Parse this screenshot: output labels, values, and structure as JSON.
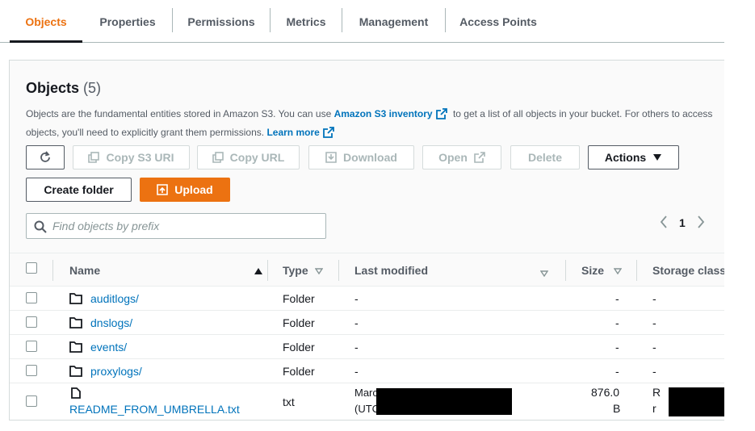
{
  "tabs": [
    "Objects",
    "Properties",
    "Permissions",
    "Metrics",
    "Management",
    "Access Points"
  ],
  "panel": {
    "title": "Objects",
    "count": "(5)",
    "desc_part1": "Objects are the fundamental entities stored in Amazon S3. You can use ",
    "desc_link1": "Amazon S3 inventory",
    "desc_part2": " to get a list of all objects in your bucket. For others to access objects, you'll need to explicitly grant them permissions. ",
    "desc_link2": "Learn more"
  },
  "toolbar": {
    "copy_s3_uri": "Copy S3 URI",
    "copy_url": "Copy URL",
    "download": "Download",
    "open": "Open",
    "delete": "Delete",
    "actions": "Actions",
    "create_folder": "Create folder",
    "upload": "Upload"
  },
  "search": {
    "placeholder": "Find objects by prefix"
  },
  "pager": {
    "page": "1"
  },
  "table": {
    "headers": {
      "name": "Name",
      "type": "Type",
      "last_modified": "Last modified",
      "size": "Size",
      "storage_class": "Storage class"
    },
    "rows": [
      {
        "name": "auditlogs/",
        "type": "Folder",
        "last_modified": "-",
        "size": "-",
        "storage_class": "-"
      },
      {
        "name": "dnslogs/",
        "type": "Folder",
        "last_modified": "-",
        "size": "-",
        "storage_class": "-"
      },
      {
        "name": "events/",
        "type": "Folder",
        "last_modified": "-",
        "size": "-",
        "storage_class": "-"
      },
      {
        "name": "proxylogs/",
        "type": "Folder",
        "last_modified": "-",
        "size": "-",
        "storage_class": "-"
      },
      {
        "name": "README_FROM_UMBRELLA.txt",
        "type": "txt",
        "last_modified_l1": "Marc",
        "last_modified_l2": "(UTC",
        "size_l1": "876.0",
        "size_l2": "B",
        "storage_class_l1": "R",
        "storage_class_l2": "r"
      }
    ]
  },
  "colors": {
    "accent": "#ec7211",
    "link": "#0073bb",
    "text": "#16191f",
    "muted": "#545b64"
  }
}
